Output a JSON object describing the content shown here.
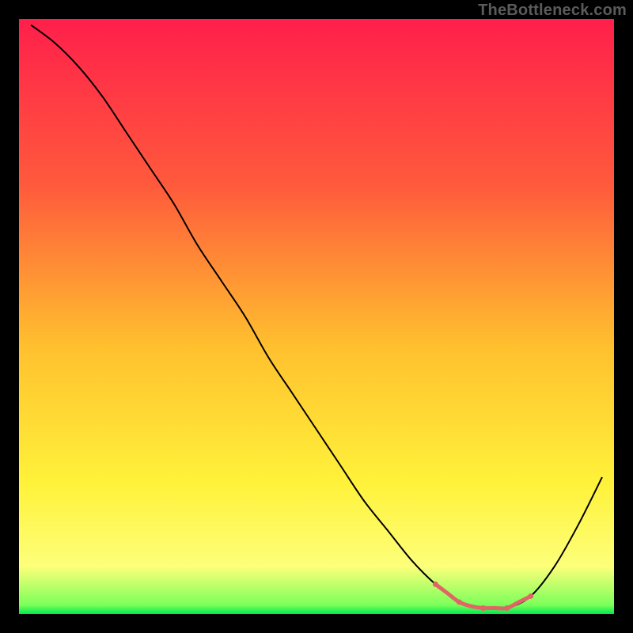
{
  "watermark": "TheBottleneck.com",
  "chart_data": {
    "type": "line",
    "title": "",
    "xlabel": "",
    "ylabel": "",
    "xlim": [
      0,
      100
    ],
    "ylim": [
      0,
      100
    ],
    "grid": false,
    "legend": false,
    "series": [
      {
        "name": "curve",
        "x": [
          2,
          6,
          10,
          14,
          18,
          22,
          26,
          30,
          34,
          38,
          42,
          46,
          50,
          54,
          58,
          62,
          66,
          70,
          74,
          78,
          82,
          86,
          90,
          94,
          98
        ],
        "y": [
          99,
          96,
          92,
          87,
          81,
          75,
          69,
          62,
          56,
          50,
          43,
          37,
          31,
          25,
          19,
          14,
          9,
          5,
          2,
          1,
          1,
          3,
          8,
          15,
          23
        ],
        "color": "#000000"
      },
      {
        "name": "highlight",
        "x": [
          70,
          72,
          74,
          76,
          78,
          80,
          82,
          84,
          86
        ],
        "y": [
          5,
          3.5,
          2,
          1.3,
          1,
          1,
          1,
          2,
          3
        ],
        "color": "#e06666"
      }
    ],
    "background_gradient_stops": [
      {
        "offset": 0.0,
        "color": "#ff1f4b"
      },
      {
        "offset": 0.28,
        "color": "#ff5a3c"
      },
      {
        "offset": 0.55,
        "color": "#ffc02e"
      },
      {
        "offset": 0.78,
        "color": "#fff23a"
      },
      {
        "offset": 0.92,
        "color": "#fdff7a"
      },
      {
        "offset": 0.985,
        "color": "#7bff5a"
      },
      {
        "offset": 1.0,
        "color": "#00e84f"
      }
    ]
  }
}
